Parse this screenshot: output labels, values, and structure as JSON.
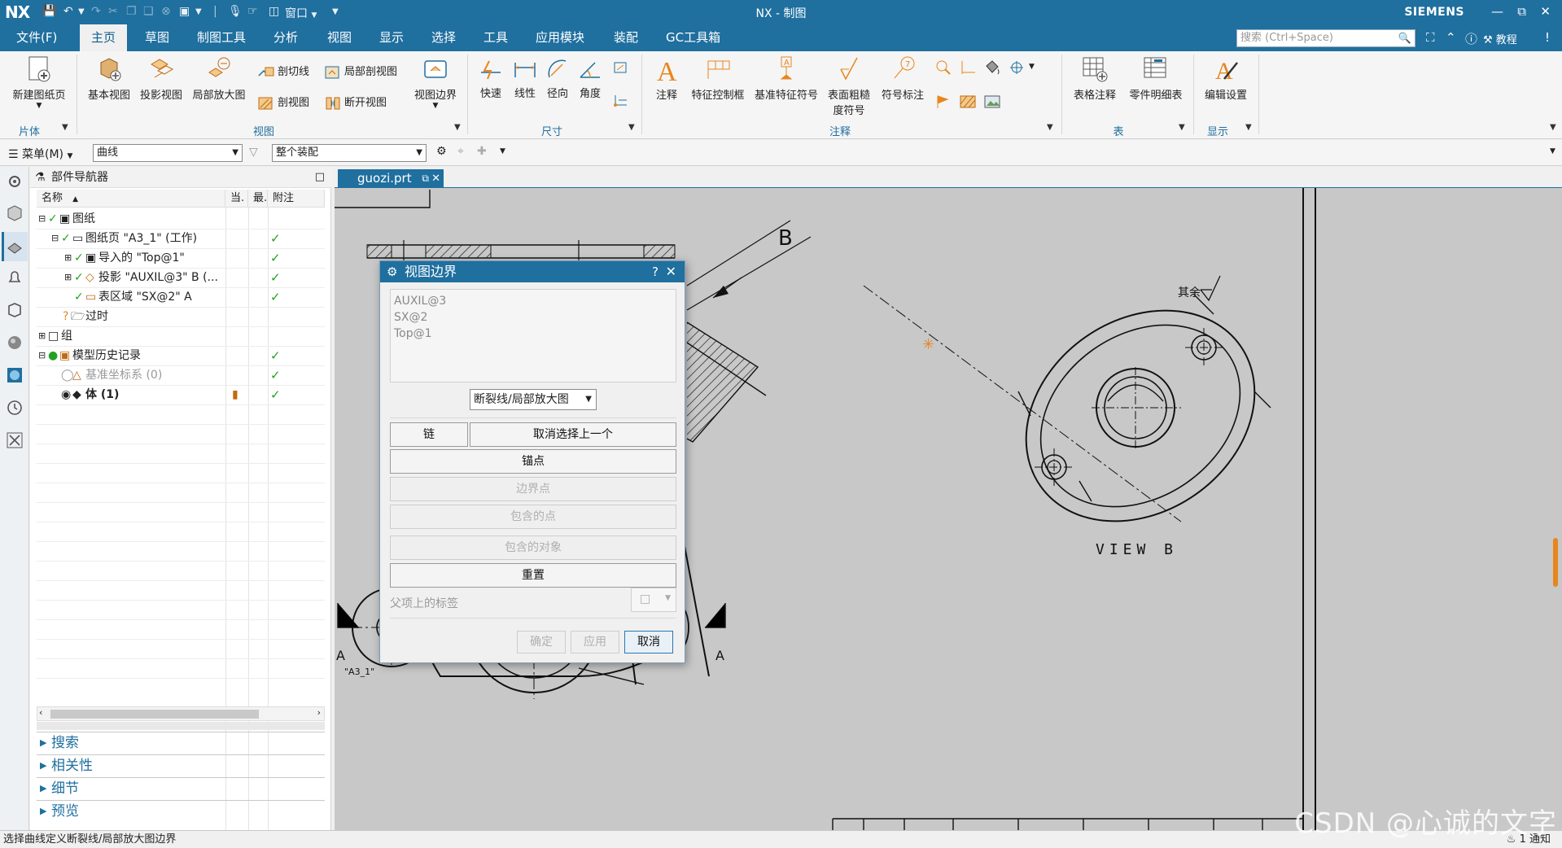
{
  "titlebar": {
    "logo": "NX",
    "window_title": "NX - 制图",
    "brand": "SIEMENS",
    "window_menu": "窗口",
    "quick_access_icons": [
      "save-icon",
      "undo-icon",
      "redo-icon",
      "copy-icon",
      "paste-icon",
      "window-icon",
      "microphone-icon",
      "touch-icon"
    ]
  },
  "menubar": {
    "tabs": [
      "文件(F)",
      "主页",
      "草图",
      "制图工具",
      "分析",
      "视图",
      "显示",
      "选择",
      "工具",
      "应用模块",
      "装配",
      "GC工具箱"
    ],
    "active_tab": "主页",
    "search_placeholder": "搜索 (Ctrl+Space)",
    "tutorial_label": "教程"
  },
  "ribbon": {
    "groups": {
      "sheet": {
        "label": "片体",
        "new_sheet": "新建图纸页"
      },
      "view": {
        "label": "视图",
        "base_view": "基本视图",
        "projected_view": "投影视图",
        "detail_view": "局部放大图",
        "section_line": "剖切线",
        "section_view": "剖视图",
        "break_out_section": "局部剖视图",
        "broken_view": "断开视图",
        "view_boundary": "视图边界"
      },
      "dimension": {
        "label": "尺寸",
        "rapid": "快速",
        "linear": "线性",
        "radial": "径向",
        "angular": "角度"
      },
      "annotation": {
        "label": "注释",
        "note": "注释",
        "fcf": "特征控制框",
        "datum_feature": "基准特征符号",
        "surface_finish_line1": "表面粗糙",
        "surface_finish_line2": "度符号",
        "id_symbol": "符号标注"
      },
      "table": {
        "label": "表",
        "tabular_note": "表格注释",
        "parts_list": "零件明细表"
      },
      "display": {
        "label": "显示",
        "edit_settings": "编辑设置"
      }
    }
  },
  "selbar": {
    "menu": "菜单(M)",
    "filter": "曲线",
    "scope": "整个装配"
  },
  "navigator": {
    "title": "部件导航器",
    "columns": [
      "名称",
      "当.",
      "最.",
      "附注"
    ],
    "rows": [
      {
        "label": "图纸",
        "checked": false
      },
      {
        "label": "图纸页 \"A3_1\" (工作)",
        "checked": true
      },
      {
        "label": "导入的 \"Top@1\"",
        "checked": true
      },
      {
        "label": "投影 \"AUXIL@3\" B (...",
        "checked": true
      },
      {
        "label": "表区域 \"SX@2\" A",
        "checked": true
      },
      {
        "label": "过时",
        "checked": false
      },
      {
        "label": "组",
        "checked": false
      },
      {
        "label": "模型历史记录",
        "checked": true
      },
      {
        "label": "基准坐标系 (0)",
        "checked": true
      },
      {
        "label": "体 (1)",
        "checked": true
      }
    ],
    "panels": [
      "搜索",
      "相关性",
      "细节",
      "预览"
    ]
  },
  "canvas": {
    "tab_label": "guozi.prt",
    "drawing_labels": {
      "arrow_b": "B",
      "rest_symbol": "其余",
      "view_b": "VIEW B",
      "section_a_left": "A",
      "section_a_right": "A",
      "sheet_name": "\"A3_1\""
    }
  },
  "dialog": {
    "title": "视图边界",
    "views": [
      "AUXIL@3",
      "SX@2",
      "Top@1"
    ],
    "boundary_type": "断裂线/局部放大图",
    "buttons": {
      "chain": "链",
      "deselect_last": "取消选择上一个",
      "anchor_point": "锚点",
      "boundary_point": "边界点",
      "contained_points": "包含的点",
      "contained_objects": "包含的对象",
      "reset": "重置",
      "ok": "确定",
      "apply": "应用",
      "cancel": "取消"
    },
    "parent_label": "父项上的标签"
  },
  "statusbar": {
    "message": "选择曲线定义断裂线/局部放大图边界",
    "notification": "1 通知"
  },
  "watermark": "CSDN @心诚的文字",
  "colors": {
    "accent": "#1f6f9f",
    "canvas_bg": "#c8c8c8",
    "check_green": "#22a122",
    "icon_orange": "#e8861e"
  }
}
